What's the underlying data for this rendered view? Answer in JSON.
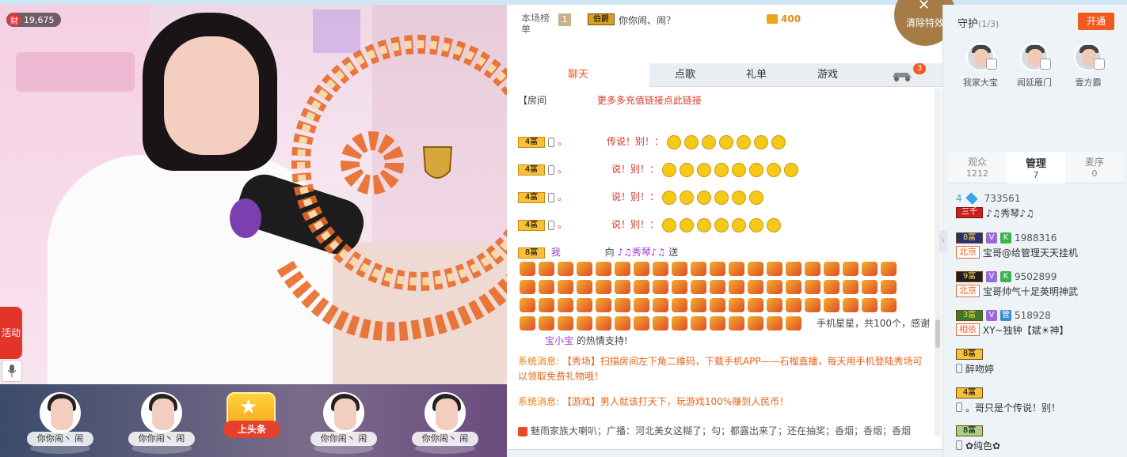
{
  "stream": {
    "rich_icon": "财",
    "rich_count": "19,675",
    "activity_label": "活动",
    "mic_icon": "microphone-icon"
  },
  "guests": [
    {
      "name": "你你闹丶 闹"
    },
    {
      "name": "你你闹丶 闹"
    },
    {
      "name": "你你闹丶 闹"
    },
    {
      "name": "你你闹丶 闹"
    }
  ],
  "headline_button": "上头条",
  "rank": {
    "label": "本场榜单",
    "position": "1",
    "badge": "伯爵",
    "name": "你你闹、闹？",
    "value": "400"
  },
  "clear_effects": "清除特效",
  "chat_tabs": [
    "聊天",
    "点歌",
    "礼单",
    "游戏"
  ],
  "car_badge": "3",
  "chat": {
    "room_notice": "【房间",
    "room_notice_link": "更多多充值链接点此链接",
    "lines": [
      {
        "level": "4富",
        "text": "。",
        "tail": "传说！别！："
      },
      {
        "level": "4富",
        "text": "。",
        "tail": "说！别！："
      },
      {
        "level": "4富",
        "text": "。",
        "tail": "说！别！："
      },
      {
        "level": "4富",
        "text": "。",
        "tail": "说！别！："
      }
    ],
    "gift_line_level": "8富",
    "gift_line_from": "我",
    "gift_line_to_prefix": "向",
    "gift_line_to": "♪♫秀琴♪♫",
    "gift_line_send": "送",
    "gift_summary": "手机星星，共100个，感谢",
    "thanks_name": "宝小宝",
    "thanks_suffix": "的热情支持!"
  },
  "system_messages": [
    {
      "tag": "系统消息:",
      "body": "【秀场】扫描房间左下角二维码，下载手机APP——石榴直播，每天用手机登陆秀场可以领取免费礼物哦！"
    },
    {
      "tag": "系统消息:",
      "body": "【游戏】男人就该打天下，玩游戏100%赚到人民币！"
    }
  ],
  "broadcast": "魅雨家族大喇叭；广播：河北美女这糊了；勾；都露出来了；还在抽奖；香烟；香烟；香烟",
  "guard": {
    "title": "守护",
    "count": "(1/3)",
    "open_button": "开通",
    "members": [
      "我家大宝",
      "闻延雁门",
      "壹方霸"
    ]
  },
  "audience_tabs": [
    {
      "label": "观众",
      "count": "1212"
    },
    {
      "label": "管理",
      "count": "7"
    },
    {
      "label": "麦序",
      "count": "0"
    }
  ],
  "viewers": [
    {
      "id": "733561",
      "rank_tag": "4",
      "level": "三千",
      "name": "♪♫秀琴♪♫"
    },
    {
      "id": "1988316",
      "level": "8富",
      "v": "V",
      "k": "K",
      "loc": "北京",
      "name": "宝哥@给管理天天挂机"
    },
    {
      "id": "9502899",
      "level": "9富",
      "v": "V",
      "k": "K",
      "loc": "北京",
      "name": "宝哥帅气十足英明神武"
    },
    {
      "id": "518928",
      "level": "3富",
      "v": "V",
      "k": "管",
      "loc": "相依",
      "name": "XY~独钟【斌☀神】"
    },
    {
      "level": "8富",
      "name": "醉吻婷"
    },
    {
      "level": "4富",
      "name": "。哥只是个传说！别！"
    },
    {
      "level": "8富",
      "name": "✿纯色✿"
    }
  ],
  "colors": {
    "accent": "#f05a1e",
    "system_orange": "#e8641a",
    "chat_bg": "#ffffff",
    "panel_bg": "#eef3f7"
  }
}
